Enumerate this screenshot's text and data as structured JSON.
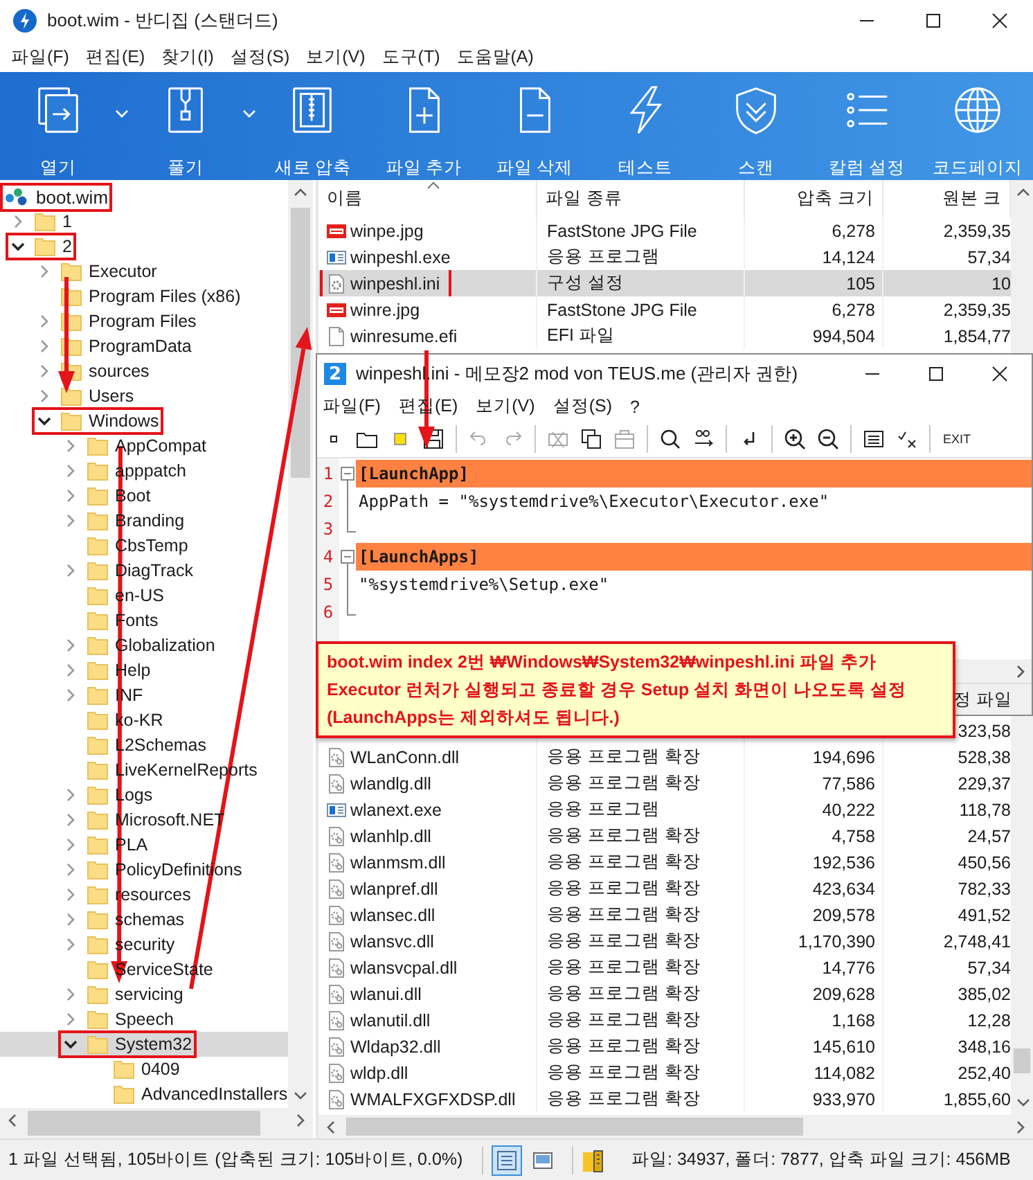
{
  "window": {
    "title": "boot.wim - 반디집 (스탠더드)"
  },
  "menu": [
    "파일(F)",
    "편집(E)",
    "찾기(I)",
    "설정(S)",
    "보기(V)",
    "도구(T)",
    "도움말(A)"
  ],
  "toolbar": [
    {
      "label": "열기",
      "kind": "open",
      "dropdown": true
    },
    {
      "label": "풀기",
      "kind": "extract",
      "dropdown": true
    },
    {
      "label": "새로 압축",
      "kind": "new",
      "dropdown": false
    },
    {
      "label": "파일 추가",
      "kind": "add",
      "dropdown": false
    },
    {
      "label": "파일 삭제",
      "kind": "delete",
      "dropdown": false
    },
    {
      "label": "테스트",
      "kind": "test",
      "dropdown": false
    },
    {
      "label": "스캔",
      "kind": "scan",
      "dropdown": false
    },
    {
      "label": "칼럼 설정",
      "kind": "columns",
      "dropdown": false
    },
    {
      "label": "코드페이지",
      "kind": "codepage",
      "dropdown": false
    }
  ],
  "tree": {
    "archive": {
      "label": "boot.wim",
      "marked": true
    },
    "items": [
      {
        "label": "1",
        "expandable": true,
        "expanded": false,
        "selected": false,
        "marked": false
      },
      {
        "label": "2",
        "expandable": true,
        "expanded": true,
        "selected": false,
        "marked": true,
        "children": [
          {
            "label": "Executor",
            "expandable": true,
            "expanded": false,
            "selected": false,
            "marked": false
          },
          {
            "label": "Program Files (x86)",
            "expandable": false,
            "selected": false,
            "marked": false
          },
          {
            "label": "Program Files",
            "expandable": true,
            "expanded": false,
            "selected": false,
            "marked": false
          },
          {
            "label": "ProgramData",
            "expandable": true,
            "expanded": false,
            "selected": false,
            "marked": false
          },
          {
            "label": "sources",
            "expandable": true,
            "expanded": false,
            "selected": false,
            "marked": false
          },
          {
            "label": "Users",
            "expandable": true,
            "expanded": false,
            "selected": false,
            "marked": false
          },
          {
            "label": "Windows",
            "expandable": true,
            "expanded": true,
            "selected": false,
            "marked": true,
            "children": [
              {
                "label": "AppCompat",
                "expandable": true,
                "expanded": false,
                "selected": false,
                "marked": false
              },
              {
                "label": "apppatch",
                "expandable": true,
                "expanded": false,
                "selected": false,
                "marked": false
              },
              {
                "label": "Boot",
                "expandable": true,
                "expanded": false,
                "selected": false,
                "marked": false
              },
              {
                "label": "Branding",
                "expandable": true,
                "expanded": false,
                "selected": false,
                "marked": false
              },
              {
                "label": "CbsTemp",
                "expandable": false,
                "selected": false,
                "marked": false
              },
              {
                "label": "DiagTrack",
                "expandable": true,
                "expanded": false,
                "selected": false,
                "marked": false
              },
              {
                "label": "en-US",
                "expandable": false,
                "selected": false,
                "marked": false
              },
              {
                "label": "Fonts",
                "expandable": false,
                "selected": false,
                "marked": false
              },
              {
                "label": "Globalization",
                "expandable": true,
                "expanded": false,
                "selected": false,
                "marked": false
              },
              {
                "label": "Help",
                "expandable": true,
                "expanded": false,
                "selected": false,
                "marked": false
              },
              {
                "label": "INF",
                "expandable": true,
                "expanded": false,
                "selected": false,
                "marked": false
              },
              {
                "label": "ko-KR",
                "expandable": false,
                "selected": false,
                "marked": false
              },
              {
                "label": "L2Schemas",
                "expandable": false,
                "selected": false,
                "marked": false
              },
              {
                "label": "LiveKernelReports",
                "expandable": false,
                "selected": false,
                "marked": false
              },
              {
                "label": "Logs",
                "expandable": true,
                "expanded": false,
                "selected": false,
                "marked": false
              },
              {
                "label": "Microsoft.NET",
                "expandable": true,
                "expanded": false,
                "selected": false,
                "marked": false
              },
              {
                "label": "PLA",
                "expandable": true,
                "expanded": false,
                "selected": false,
                "marked": false
              },
              {
                "label": "PolicyDefinitions",
                "expandable": true,
                "expanded": false,
                "selected": false,
                "marked": false
              },
              {
                "label": "resources",
                "expandable": true,
                "expanded": false,
                "selected": false,
                "marked": false
              },
              {
                "label": "schemas",
                "expandable": true,
                "expanded": false,
                "selected": false,
                "marked": false
              },
              {
                "label": "security",
                "expandable": true,
                "expanded": false,
                "selected": false,
                "marked": false
              },
              {
                "label": "ServiceState",
                "expandable": false,
                "selected": false,
                "marked": false
              },
              {
                "label": "servicing",
                "expandable": true,
                "expanded": false,
                "selected": false,
                "marked": false
              },
              {
                "label": "Speech",
                "expandable": true,
                "expanded": false,
                "selected": false,
                "marked": false
              },
              {
                "label": "System32",
                "expandable": true,
                "expanded": true,
                "selected": true,
                "marked": true,
                "children": [
                  {
                    "label": "0409",
                    "expandable": false,
                    "selected": false,
                    "marked": false
                  },
                  {
                    "label": "AdvancedInstallers",
                    "expandable": false,
                    "selected": false,
                    "marked": false
                  }
                ]
              }
            ]
          }
        ]
      }
    ]
  },
  "file_list": {
    "columns": [
      "이름",
      "파일 종류",
      "압축 크기",
      "원본 크"
    ],
    "rows": [
      {
        "name": "winpe.jpg",
        "type": "FastStone JPG File",
        "compressed": "6,278",
        "original": "2,359,35",
        "kind": "jpg",
        "selected": false,
        "marked": false
      },
      {
        "name": "winpeshl.exe",
        "type": "응용 프로그램",
        "compressed": "14,124",
        "original": "57,34",
        "kind": "exe",
        "selected": false,
        "marked": false
      },
      {
        "name": "winpeshl.ini",
        "type": "구성 설정",
        "compressed": "105",
        "original": "10",
        "kind": "ini",
        "selected": true,
        "marked": true
      },
      {
        "name": "winre.jpg",
        "type": "FastStone JPG File",
        "compressed": "6,278",
        "original": "2,359,35",
        "kind": "jpg",
        "selected": false,
        "marked": false
      },
      {
        "name": "winresume.efi",
        "type": "EFI 파일",
        "compressed": "994,504",
        "original": "1,854,77",
        "kind": "efi",
        "selected": false,
        "marked": false
      }
    ],
    "lower_rows": [
      {
        "original": "323,58"
      },
      {
        "name": "WLanConn.dll",
        "type": "응용 프로그램 확장",
        "compressed": "194,696",
        "original": "528,38",
        "kind": "dll",
        "selected": false,
        "marked": false
      },
      {
        "name": "wlandlg.dll",
        "type": "응용 프로그램 확장",
        "compressed": "77,586",
        "original": "229,37",
        "kind": "dll",
        "selected": false,
        "marked": false
      },
      {
        "name": "wlanext.exe",
        "type": "응용 프로그램",
        "compressed": "40,222",
        "original": "118,78",
        "kind": "exe",
        "selected": false,
        "marked": false
      },
      {
        "name": "wlanhlp.dll",
        "type": "응용 프로그램 확장",
        "compressed": "4,758",
        "original": "24,57",
        "kind": "dll",
        "selected": false,
        "marked": false
      },
      {
        "name": "wlanmsm.dll",
        "type": "응용 프로그램 확장",
        "compressed": "192,536",
        "original": "450,56",
        "kind": "dll",
        "selected": false,
        "marked": false
      },
      {
        "name": "wlanpref.dll",
        "type": "응용 프로그램 확장",
        "compressed": "423,634",
        "original": "782,33",
        "kind": "dll",
        "selected": false,
        "marked": false
      },
      {
        "name": "wlansec.dll",
        "type": "응용 프로그램 확장",
        "compressed": "209,578",
        "original": "491,52",
        "kind": "dll",
        "selected": false,
        "marked": false
      },
      {
        "name": "wlansvc.dll",
        "type": "응용 프로그램 확장",
        "compressed": "1,170,390",
        "original": "2,748,41",
        "kind": "dll",
        "selected": false,
        "marked": false
      },
      {
        "name": "wlansvcpal.dll",
        "type": "응용 프로그램 확장",
        "compressed": "14,776",
        "original": "57,34",
        "kind": "dll",
        "selected": false,
        "marked": false
      },
      {
        "name": "wlanui.dll",
        "type": "응용 프로그램 확장",
        "compressed": "209,628",
        "original": "385,02",
        "kind": "dll",
        "selected": false,
        "marked": false
      },
      {
        "name": "wlanutil.dll",
        "type": "응용 프로그램 확장",
        "compressed": "1,168",
        "original": "12,28",
        "kind": "dll",
        "selected": false,
        "marked": false
      },
      {
        "name": "Wldap32.dll",
        "type": "응용 프로그램 확장",
        "compressed": "145,610",
        "original": "348,16",
        "kind": "dll",
        "selected": false,
        "marked": false
      },
      {
        "name": "wldp.dll",
        "type": "응용 프로그램 확장",
        "compressed": "114,082",
        "original": "252,40",
        "kind": "dll",
        "selected": false,
        "marked": false
      },
      {
        "name": "WMALFXGFXDSP.dll",
        "type": "응용 프로그램 확장",
        "compressed": "933,970",
        "original": "1,855,60",
        "kind": "dll",
        "selected": false,
        "marked": false
      }
    ]
  },
  "notepad": {
    "logo": "2",
    "title": "winpeshl.ini - 메모장2 mod von TEUS.me (관리자 권한)",
    "menu": [
      "파일(F)",
      "편집(E)",
      "보기(V)",
      "설정(S)",
      "?"
    ],
    "tools": [
      {
        "kind": "new",
        "disabled": false
      },
      {
        "kind": "open",
        "disabled": false
      },
      {
        "kind": "marker",
        "disabled": false
      },
      {
        "kind": "save",
        "disabled": false
      },
      {
        "kind": "separator"
      },
      {
        "kind": "undo",
        "disabled": true
      },
      {
        "kind": "redo",
        "disabled": true
      },
      {
        "kind": "separator"
      },
      {
        "kind": "cut",
        "disabled": true
      },
      {
        "kind": "copy",
        "disabled": false
      },
      {
        "kind": "paste",
        "disabled": true
      },
      {
        "kind": "separator"
      },
      {
        "kind": "find",
        "disabled": false
      },
      {
        "kind": "replace",
        "disabled": false
      },
      {
        "kind": "separator"
      },
      {
        "kind": "wrap",
        "disabled": false
      },
      {
        "kind": "separator"
      },
      {
        "kind": "zoomin",
        "disabled": false
      },
      {
        "kind": "zoomout",
        "disabled": false
      },
      {
        "kind": "separator"
      },
      {
        "kind": "list",
        "disabled": false
      },
      {
        "kind": "checkx",
        "disabled": false
      },
      {
        "kind": "separator"
      },
      {
        "kind": "text",
        "label": "EXIT",
        "disabled": false
      }
    ],
    "lines": [
      {
        "number": "1",
        "text": "[LaunchApp]",
        "section": true
      },
      {
        "number": "2",
        "text": "AppPath = \"%systemdrive%\\Executor\\Executor.exe\"",
        "section": false
      },
      {
        "number": "3",
        "section": false
      },
      {
        "number": "4",
        "text": "[LaunchApps]",
        "section": true
      },
      {
        "number": "5",
        "text": "\"%systemdrive%\\Setup.exe\"",
        "section": false
      },
      {
        "number": "6",
        "section": false
      }
    ],
    "status": "정 파일"
  },
  "callout": [
    "boot.wim index 2번 ₩Windows₩System32₩winpeshl.ini 파일 추가",
    "Executor 런처가 실행되고 종료할 경우 Setup 설치 화면이 나오도록 설정",
    "(LaunchApps는 제외하셔도 됩니다.)"
  ],
  "status_bar": {
    "selection": "1 파일 선택됨, 105바이트 (압축된 크기: 105바이트, 0.0%)",
    "views": [
      {
        "kind": "details",
        "selected": true
      },
      {
        "kind": "thumbnails",
        "selected": false
      }
    ],
    "summary": "파일: 34937, 폴더: 7877, 압축 파일 크기: 456MB"
  }
}
